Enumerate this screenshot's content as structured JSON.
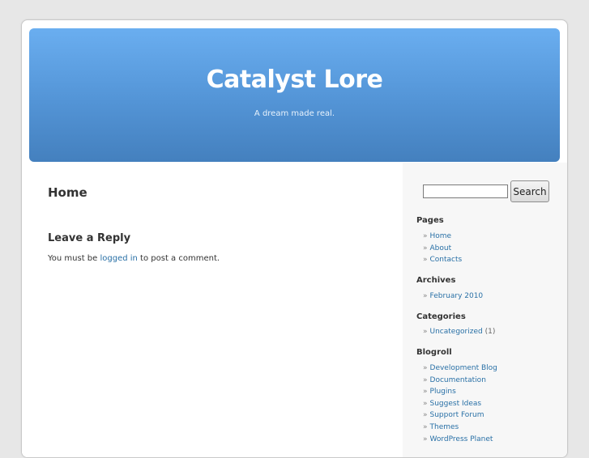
{
  "header": {
    "title": "Catalyst Lore",
    "description": "A dream made real."
  },
  "main": {
    "page_title": "Home",
    "reply_title": "Leave a Reply",
    "must_login": {
      "prefix": "You must be ",
      "link": "logged in",
      "suffix": " to post a comment."
    }
  },
  "sidebar": {
    "search": {
      "placeholder": "",
      "button_label": "Search"
    },
    "pages": {
      "title": "Pages",
      "items": [
        "Home",
        "About",
        "Contacts"
      ]
    },
    "archives": {
      "title": "Archives",
      "items": [
        "February 2010"
      ]
    },
    "categories": {
      "title": "Categories",
      "items": [
        {
          "label": "Uncategorized",
          "count": "(1)"
        }
      ]
    },
    "blogroll": {
      "title": "Blogroll",
      "items": [
        "Development Blog",
        "Documentation",
        "Plugins",
        "Suggest Ideas",
        "Support Forum",
        "Themes",
        "WordPress Planet"
      ]
    },
    "bullet": "»"
  },
  "colors": {
    "header_gradient_top": "#6aaef0",
    "header_gradient_bottom": "#4480be",
    "link": "#2970a6",
    "page_background": "#e7e7e7",
    "sidebar_background": "#f7f7f7"
  }
}
